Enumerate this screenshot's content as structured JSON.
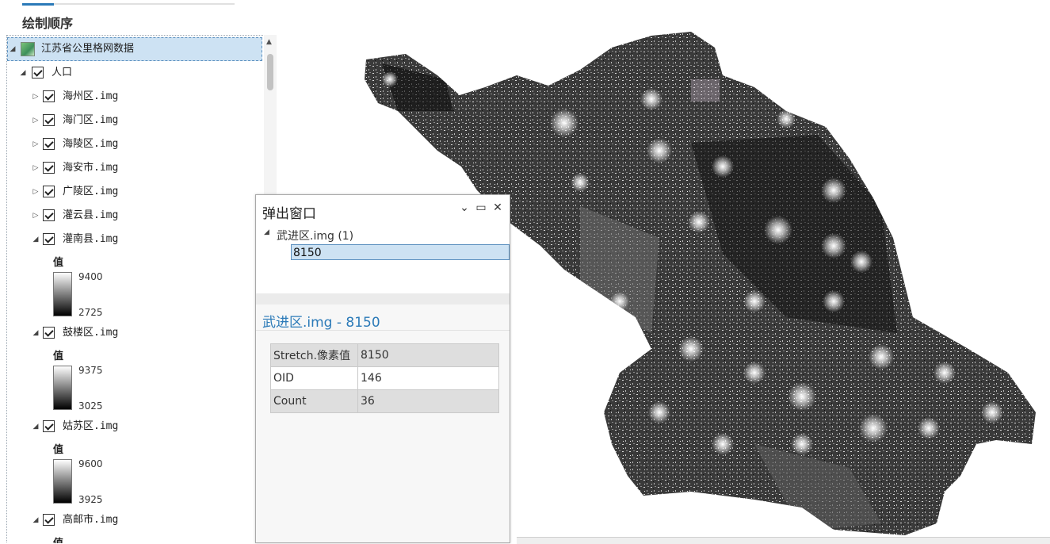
{
  "contents_pane": {
    "title": "绘制顺序",
    "map_layer": "江苏省公里格网数据",
    "group": "人口",
    "collapsed_layers": [
      "海州区.img",
      "海门区.img",
      "海陵区.img",
      "海安市.img",
      "广陵区.img",
      "灌云县.img"
    ],
    "expanded_layers": [
      {
        "name": "灌南县.img",
        "value_header": "值",
        "high": "9400",
        "low": "2725"
      },
      {
        "name": "鼓楼区.img",
        "value_header": "值",
        "high": "9375",
        "low": "3025"
      },
      {
        "name": "姑苏区.img",
        "value_header": "值",
        "high": "9600",
        "low": "3925"
      },
      {
        "name": "高邮市.img",
        "value_header": "值"
      }
    ]
  },
  "popup": {
    "title": "弹出窗口",
    "buttons": {
      "dropdown": "⌄",
      "maximize": "▭",
      "close": "✕"
    },
    "layer_entry": "武进区.img (1)",
    "feature_value": "8150",
    "feature_header": "武进区.img - 8150",
    "attributes": [
      {
        "field": "Stretch.像素值",
        "value": "8150"
      },
      {
        "field": "OID",
        "value": "146"
      },
      {
        "field": "Count",
        "value": "36"
      }
    ]
  },
  "icons": {
    "expand": "expand-triangle-icon",
    "collapse": "collapse-triangle-icon",
    "checkbox": "checkbox-checked-icon",
    "raster": "raster-layer-icon"
  },
  "colors": {
    "accent": "#2b7ab8",
    "selection": "#cde2f3"
  }
}
